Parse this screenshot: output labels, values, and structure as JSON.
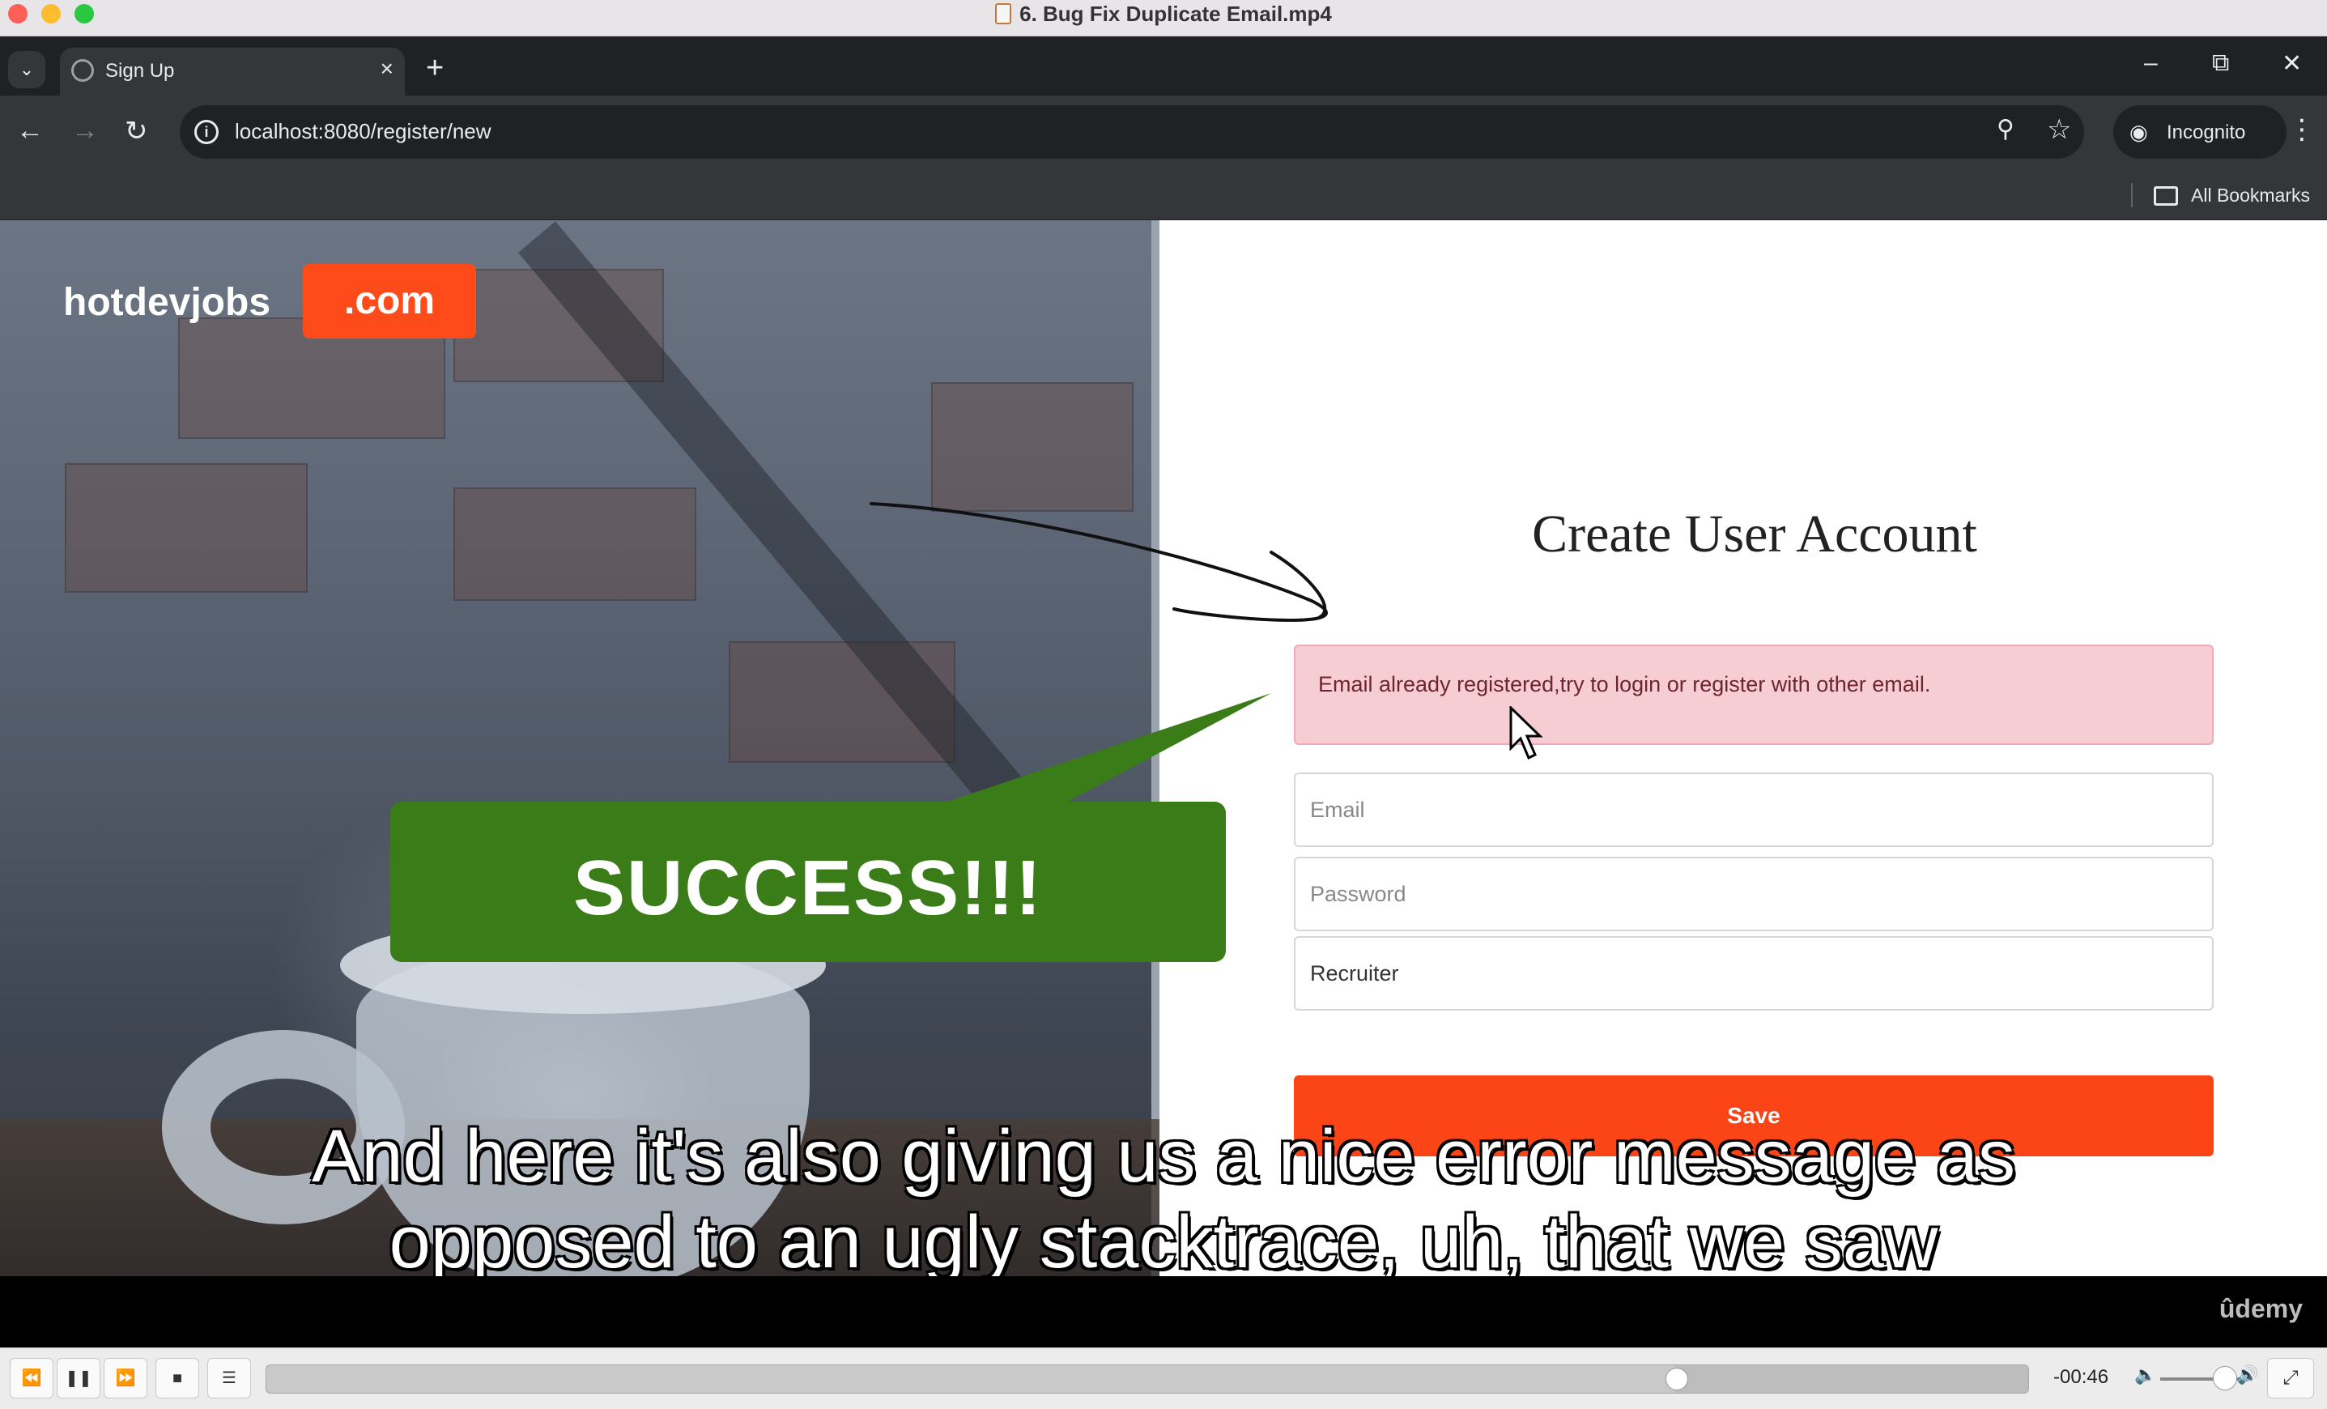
{
  "window": {
    "title": "6. Bug Fix Duplicate Email.mp4"
  },
  "browser": {
    "tab_title": "Sign Up",
    "url": "localhost:8080/register/new",
    "incognito_label": "Incognito",
    "bookmarks_label": "All Bookmarks"
  },
  "page": {
    "logo_text": "hotdevjobs",
    "logo_suffix": ".com",
    "form_title": "Create User Account",
    "error_message": "Email already registered,try to login or register with other email.",
    "email_placeholder": "Email",
    "password_placeholder": "Password",
    "user_type_selected": "Recruiter",
    "save_label": "Save"
  },
  "overlay": {
    "bubble_text": "SUCCESS!!!",
    "bubble_color": "#3a7c17",
    "caption_line1": "And here it's also giving us a nice error message as",
    "caption_line2": "opposed to an ugly stacktrace, uh, that we saw"
  },
  "player": {
    "watermark": "ûdemy",
    "time_remaining": "-00:46",
    "progress": 0.8,
    "volume": 0.8
  },
  "colors": {
    "accent": "#fc4516",
    "alert_bg": "#f6cdd2"
  }
}
